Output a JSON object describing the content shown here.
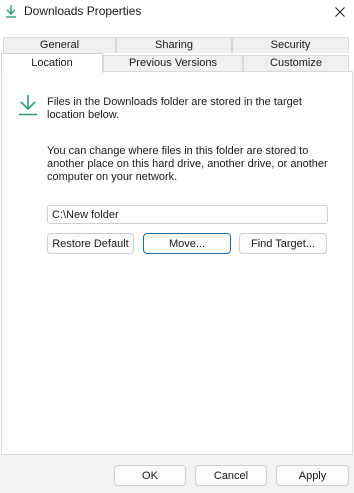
{
  "window": {
    "title": "Downloads Properties",
    "close_glyph": "✕"
  },
  "tabs_top": [
    {
      "label": "General"
    },
    {
      "label": "Sharing"
    },
    {
      "label": "Security"
    }
  ],
  "tabs_bottom": [
    {
      "label": "Location",
      "active": true
    },
    {
      "label": "Previous Versions"
    },
    {
      "label": "Customize"
    }
  ],
  "location": {
    "icon": "download-arrow-icon",
    "info_text": "Files in the Downloads folder are stored in the target location below.",
    "description": "You can change where files in this folder are stored to another place on this hard drive, another drive, or another computer on your network.",
    "path_value": "C:\\New folder",
    "restore_default_label": "Restore Default",
    "move_label": "Move...",
    "find_target_label": "Find Target..."
  },
  "footer": {
    "ok_label": "OK",
    "cancel_label": "Cancel",
    "apply_label": "Apply"
  },
  "colors": {
    "accent": "#1f6fb3",
    "icon_green": "#2e9e6e"
  }
}
